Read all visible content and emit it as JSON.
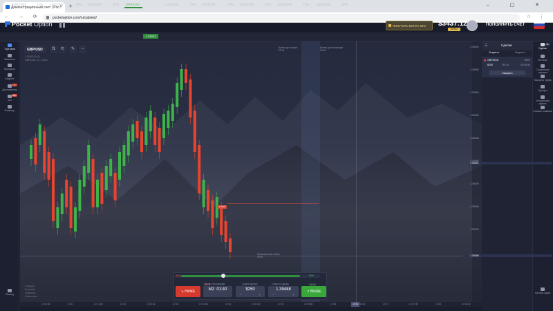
{
  "browser": {
    "tab_title": "Демонстрационный счет | Poc...",
    "tab_close": "×",
    "new_tab": "+",
    "window_controls": "–  ▢  ✕",
    "nav": "← → ⟳",
    "url": "pocketoption.com/ru/cabinet/",
    "url_icons": "☆ ⋮"
  },
  "header": {
    "logo_bold": "Pocket",
    "logo_light": "Option",
    "bonus": "ПОЛУЧИТЬ БОНУС 50%",
    "balance": "$3437.12",
    "balance_sub": "DEMO",
    "topup": "ПОПОЛНИТЬ СЧЕТ",
    "colors": {
      "accent": "#2b6fd8",
      "green": "#38a83a",
      "red": "#d63a2e",
      "gold": "#e2b84a"
    }
  },
  "pairs": [
    {
      "name": "EUR/USD",
      "pct": "72%"
    },
    {
      "name": "USD/JPY",
      "pct": "72%"
    },
    {
      "name": "AUD/JPY",
      "pct": "67%"
    },
    {
      "name": "GBP/USD",
      "pct": "",
      "active": true
    },
    {
      "name": "AUD/USD",
      "pct": "72%"
    },
    {
      "name": "EUR/JPY",
      "pct": "72%"
    },
    {
      "name": "NZD/USD",
      "pct": "72%"
    },
    {
      "name": "USD/CHF",
      "pct": "72%"
    },
    {
      "name": "USD/CAD",
      "pct": "67%"
    }
  ],
  "pair_active_value": "1.39321",
  "left_sidebar": [
    {
      "label": "Торговля",
      "icon": "chart-icon",
      "active": true
    },
    {
      "label": "Финансы",
      "icon": "dollar-icon"
    },
    {
      "label": "Профиль",
      "icon": "user-icon"
    },
    {
      "label": "Маркет",
      "icon": "cart-icon"
    },
    {
      "label": "Достижения",
      "icon": "trophy-icon",
      "badge": "1"
    },
    {
      "label": "Чат",
      "icon": "chat-icon",
      "badge": "99+"
    },
    {
      "label": "Помощь",
      "icon": "help-icon"
    }
  ],
  "left_sidebar_bottom": "Выход",
  "toolbar": {
    "symbol": "GBP/USD",
    "symbol_sub1": "1.39,83,04 (1)",
    "symbol_sub2": "GBP/USD, 1s • Open",
    "icons": [
      "⇅",
      "⚟",
      "✎",
      "−"
    ]
  },
  "chart_labels": {
    "label1": "Время до покупки",
    "label1_time": "00:00",
    "label2": "Время до экспирации",
    "label2_time": "00:00",
    "label3": "Минимальный объем",
    "label3_val": "00:00",
    "marker": "1.3945",
    "price_ticks": [
      "1.39600",
      "1.39550",
      "1.39500",
      "1.39450",
      "1.39400",
      "1.39350",
      "1.39300",
      "1.39250",
      "1.39200"
    ],
    "price_current": "1.39321",
    "price_low": "1.39265",
    "bottom_left": [
      "Стандарт",
      "Японский",
      "Линейный",
      "Хайкен-аши"
    ],
    "time_ticks": [
      "17:00:30",
      "17:01",
      "17:01:30",
      "17:02",
      "17:02:30",
      "17:03",
      "17:03:30",
      "17:04",
      "17:04:30",
      "17:05",
      "17:05:30",
      "17:06",
      "17:06:30",
      "17:07",
      "17:07:30",
      "17:08",
      "17:08:30"
    ],
    "time_marker": "17:56"
  },
  "trade": {
    "timer_left": "Вниз",
    "timer_right": "50%",
    "sell_pct": "+$208",
    "buy_pct": "+$208",
    "sell_label": "↘ НИЖЕ",
    "buy_label": "↗ ВЫШЕ",
    "time_caption": "Время экспирации",
    "time_mode": "M2",
    "time_value": "01:40",
    "amount_caption": "Сумма сделки",
    "amount": "$250",
    "price_caption": "Открыть сделку",
    "price": "1.39488",
    "profit_caption": "+$208"
  },
  "right_panel": {
    "title": "Сделки",
    "tab_open": "Открыто",
    "tab_closed": "Закрыто",
    "trade_pair": "GBP/USD",
    "trade_pct": "+80%",
    "trade_amount": "$100",
    "trade_payout": "$0.10",
    "trade_time": "00:00:50",
    "close_btn": "Закрыть"
  },
  "right_sidebar": [
    {
      "label": "Сделки",
      "icon": "trades-icon",
      "active": true,
      "badge": "41"
    },
    {
      "label": "Сигналы",
      "icon": "signal-icon"
    },
    {
      "label": "Социальная торговля",
      "icon": "social-icon"
    },
    {
      "label": "Экспресс трейд",
      "icon": "express-icon"
    },
    {
      "label": "Турниры",
      "icon": "tournament-icon"
    },
    {
      "label": "Отложенные сделки",
      "icon": "pending-icon"
    },
    {
      "label": "Горячие клавиши",
      "icon": "hotkeys-icon"
    }
  ],
  "right_sidebar_bottom": "На весь экран"
}
